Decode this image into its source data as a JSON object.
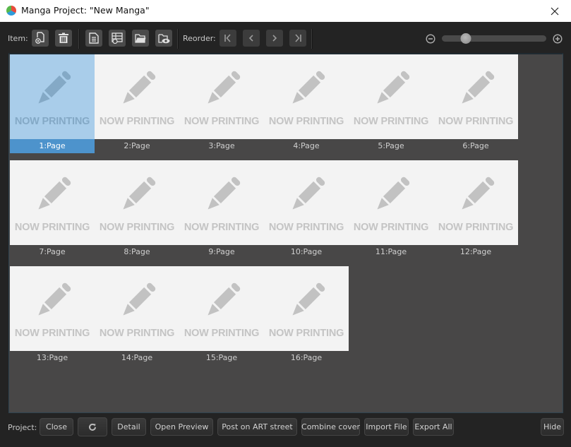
{
  "window": {
    "title": "Manga Project: \"New Manga\"",
    "close_icon": "close-x-icon"
  },
  "toolbar": {
    "item_label": "Item:",
    "item_buttons": [
      {
        "name": "add-page-button",
        "icon": "add-page-icon"
      },
      {
        "name": "delete-page-button",
        "icon": "trash-icon"
      }
    ],
    "file_buttons": [
      {
        "name": "page-settings-button",
        "icon": "document-icon"
      },
      {
        "name": "page-template-button",
        "icon": "table-clock-icon"
      },
      {
        "name": "open-folder-button",
        "icon": "folder-icon"
      },
      {
        "name": "preview-folder-button",
        "icon": "folder-eye-icon"
      }
    ],
    "reorder_label": "Reorder:",
    "reorder_buttons": [
      {
        "name": "move-first-button",
        "icon": "first-icon"
      },
      {
        "name": "move-prev-button",
        "icon": "prev-icon"
      },
      {
        "name": "move-next-button",
        "icon": "next-icon"
      },
      {
        "name": "move-last-button",
        "icon": "last-icon"
      }
    ],
    "zoom_slider_value": 0.2
  },
  "pages": [
    {
      "label": "1:Page",
      "placeholder": "NOW PRINTING",
      "selected": true
    },
    {
      "label": "2:Page",
      "placeholder": "NOW PRINTING",
      "selected": false
    },
    {
      "label": "3:Page",
      "placeholder": "NOW PRINTING",
      "selected": false
    },
    {
      "label": "4:Page",
      "placeholder": "NOW PRINTING",
      "selected": false
    },
    {
      "label": "5:Page",
      "placeholder": "NOW PRINTING",
      "selected": false
    },
    {
      "label": "6:Page",
      "placeholder": "NOW PRINTING",
      "selected": false
    },
    {
      "label": "7:Page",
      "placeholder": "NOW PRINTING",
      "selected": false
    },
    {
      "label": "8:Page",
      "placeholder": "NOW PRINTING",
      "selected": false
    },
    {
      "label": "9:Page",
      "placeholder": "NOW PRINTING",
      "selected": false
    },
    {
      "label": "10:Page",
      "placeholder": "NOW PRINTING",
      "selected": false
    },
    {
      "label": "11:Page",
      "placeholder": "NOW PRINTING",
      "selected": false
    },
    {
      "label": "12:Page",
      "placeholder": "NOW PRINTING",
      "selected": false
    },
    {
      "label": "13:Page",
      "placeholder": "NOW PRINTING",
      "selected": false
    },
    {
      "label": "14:Page",
      "placeholder": "NOW PRINTING",
      "selected": false
    },
    {
      "label": "15:Page",
      "placeholder": "NOW PRINTING",
      "selected": false
    },
    {
      "label": "16:Page",
      "placeholder": "NOW PRINTING",
      "selected": false
    }
  ],
  "bottom": {
    "project_label": "Project:",
    "buttons": [
      {
        "name": "close-button",
        "label": "Close"
      },
      {
        "name": "refresh-button",
        "label": ""
      },
      {
        "name": "detail-button",
        "label": "Detail"
      },
      {
        "name": "open-preview-button",
        "label": "Open Preview"
      },
      {
        "name": "post-art-street-button",
        "label": "Post on ART street"
      },
      {
        "name": "combine-cover-button",
        "label": "Combine cover"
      },
      {
        "name": "import-file-button",
        "label": "Import File"
      },
      {
        "name": "export-all-button",
        "label": "Export All"
      },
      {
        "name": "hide-button",
        "label": "Hide"
      }
    ]
  },
  "colors": {
    "selection": "#4d93cc",
    "selection_thumb": "#a9cdea",
    "grid_bg": "#484747",
    "window_bg": "#232323"
  }
}
